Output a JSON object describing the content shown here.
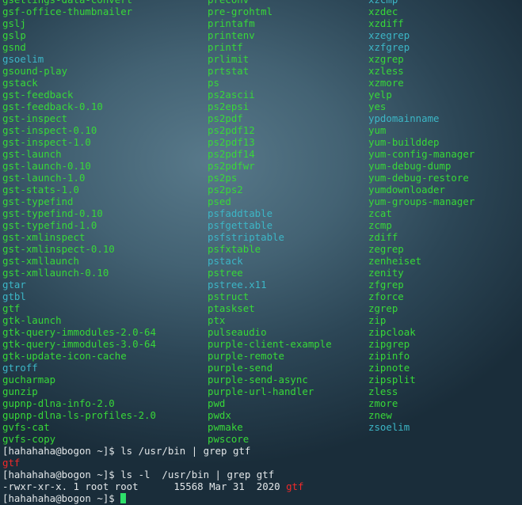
{
  "listing": {
    "col1": [
      {
        "n": "gsettings-data-convert",
        "t": "ex"
      },
      {
        "n": "gsf-office-thumbnailer",
        "t": "ex"
      },
      {
        "n": "gslj",
        "t": "ex"
      },
      {
        "n": "gslp",
        "t": "ex"
      },
      {
        "n": "gsnd",
        "t": "ex"
      },
      {
        "n": "gsoelim",
        "t": "ln"
      },
      {
        "n": "gsound-play",
        "t": "ex"
      },
      {
        "n": "gstack",
        "t": "ex"
      },
      {
        "n": "gst-feedback",
        "t": "ex"
      },
      {
        "n": "gst-feedback-0.10",
        "t": "ex"
      },
      {
        "n": "gst-inspect",
        "t": "ex"
      },
      {
        "n": "gst-inspect-0.10",
        "t": "ex"
      },
      {
        "n": "gst-inspect-1.0",
        "t": "ex"
      },
      {
        "n": "gst-launch",
        "t": "ex"
      },
      {
        "n": "gst-launch-0.10",
        "t": "ex"
      },
      {
        "n": "gst-launch-1.0",
        "t": "ex"
      },
      {
        "n": "gst-stats-1.0",
        "t": "ex"
      },
      {
        "n": "gst-typefind",
        "t": "ex"
      },
      {
        "n": "gst-typefind-0.10",
        "t": "ex"
      },
      {
        "n": "gst-typefind-1.0",
        "t": "ex"
      },
      {
        "n": "gst-xmlinspect",
        "t": "ex"
      },
      {
        "n": "gst-xmlinspect-0.10",
        "t": "ex"
      },
      {
        "n": "gst-xmllaunch",
        "t": "ex"
      },
      {
        "n": "gst-xmllaunch-0.10",
        "t": "ex"
      },
      {
        "n": "gtar",
        "t": "ln"
      },
      {
        "n": "gtbl",
        "t": "ln"
      },
      {
        "n": "gtf",
        "t": "ex"
      },
      {
        "n": "gtk-launch",
        "t": "ex"
      },
      {
        "n": "gtk-query-immodules-2.0-64",
        "t": "ex"
      },
      {
        "n": "gtk-query-immodules-3.0-64",
        "t": "ex"
      },
      {
        "n": "gtk-update-icon-cache",
        "t": "ex"
      },
      {
        "n": "gtroff",
        "t": "ln"
      },
      {
        "n": "gucharmap",
        "t": "ex"
      },
      {
        "n": "gunzip",
        "t": "ex"
      },
      {
        "n": "gupnp-dlna-info-2.0",
        "t": "ex"
      },
      {
        "n": "gupnp-dlna-ls-profiles-2.0",
        "t": "ex"
      },
      {
        "n": "gvfs-cat",
        "t": "ex"
      },
      {
        "n": "gvfs-copy",
        "t": "ex"
      }
    ],
    "col2": [
      {
        "n": "preconv",
        "t": "ex"
      },
      {
        "n": "pre-grohtml",
        "t": "ex"
      },
      {
        "n": "printafm",
        "t": "ex"
      },
      {
        "n": "printenv",
        "t": "ex"
      },
      {
        "n": "printf",
        "t": "ex"
      },
      {
        "n": "prlimit",
        "t": "ex"
      },
      {
        "n": "prtstat",
        "t": "ex"
      },
      {
        "n": "ps",
        "t": "ex"
      },
      {
        "n": "ps2ascii",
        "t": "ex"
      },
      {
        "n": "ps2epsi",
        "t": "ex"
      },
      {
        "n": "ps2pdf",
        "t": "ex"
      },
      {
        "n": "ps2pdf12",
        "t": "ex"
      },
      {
        "n": "ps2pdf13",
        "t": "ex"
      },
      {
        "n": "ps2pdf14",
        "t": "ex"
      },
      {
        "n": "ps2pdfwr",
        "t": "ex"
      },
      {
        "n": "ps2ps",
        "t": "ex"
      },
      {
        "n": "ps2ps2",
        "t": "ex"
      },
      {
        "n": "psed",
        "t": "ex"
      },
      {
        "n": "psfaddtable",
        "t": "ln"
      },
      {
        "n": "psfgettable",
        "t": "ln"
      },
      {
        "n": "psfstriptable",
        "t": "ln"
      },
      {
        "n": "psfxtable",
        "t": "ex"
      },
      {
        "n": "pstack",
        "t": "ln"
      },
      {
        "n": "pstree",
        "t": "ex"
      },
      {
        "n": "pstree.x11",
        "t": "ln"
      },
      {
        "n": "pstruct",
        "t": "ex"
      },
      {
        "n": "ptaskset",
        "t": "ex"
      },
      {
        "n": "ptx",
        "t": "ex"
      },
      {
        "n": "pulseaudio",
        "t": "ex"
      },
      {
        "n": "purple-client-example",
        "t": "ex"
      },
      {
        "n": "purple-remote",
        "t": "ex"
      },
      {
        "n": "purple-send",
        "t": "ex"
      },
      {
        "n": "purple-send-async",
        "t": "ex"
      },
      {
        "n": "purple-url-handler",
        "t": "ex"
      },
      {
        "n": "pwd",
        "t": "ex"
      },
      {
        "n": "pwdx",
        "t": "ex"
      },
      {
        "n": "pwmake",
        "t": "ex"
      },
      {
        "n": "pwscore",
        "t": "ex"
      }
    ],
    "col3": [
      {
        "n": "xzcmp",
        "t": "ln"
      },
      {
        "n": "xzdec",
        "t": "ex"
      },
      {
        "n": "xzdiff",
        "t": "ex"
      },
      {
        "n": "xzegrep",
        "t": "ln"
      },
      {
        "n": "xzfgrep",
        "t": "ln"
      },
      {
        "n": "xzgrep",
        "t": "ex"
      },
      {
        "n": "xzless",
        "t": "ex"
      },
      {
        "n": "xzmore",
        "t": "ex"
      },
      {
        "n": "yelp",
        "t": "ex"
      },
      {
        "n": "yes",
        "t": "ex"
      },
      {
        "n": "ypdomainname",
        "t": "ln"
      },
      {
        "n": "yum",
        "t": "ex"
      },
      {
        "n": "yum-builddep",
        "t": "ex"
      },
      {
        "n": "yum-config-manager",
        "t": "ex"
      },
      {
        "n": "yum-debug-dump",
        "t": "ex"
      },
      {
        "n": "yum-debug-restore",
        "t": "ex"
      },
      {
        "n": "yumdownloader",
        "t": "ex"
      },
      {
        "n": "yum-groups-manager",
        "t": "ex"
      },
      {
        "n": "zcat",
        "t": "ex"
      },
      {
        "n": "zcmp",
        "t": "ex"
      },
      {
        "n": "zdiff",
        "t": "ex"
      },
      {
        "n": "zegrep",
        "t": "ex"
      },
      {
        "n": "zenheiset",
        "t": "ex"
      },
      {
        "n": "zenity",
        "t": "ex"
      },
      {
        "n": "zfgrep",
        "t": "ex"
      },
      {
        "n": "zforce",
        "t": "ex"
      },
      {
        "n": "zgrep",
        "t": "ex"
      },
      {
        "n": "zip",
        "t": "ex"
      },
      {
        "n": "zipcloak",
        "t": "ex"
      },
      {
        "n": "zipgrep",
        "t": "ex"
      },
      {
        "n": "zipinfo",
        "t": "ex"
      },
      {
        "n": "zipnote",
        "t": "ex"
      },
      {
        "n": "zipsplit",
        "t": "ex"
      },
      {
        "n": "zless",
        "t": "ex"
      },
      {
        "n": "zmore",
        "t": "ex"
      },
      {
        "n": "znew",
        "t": "ex"
      },
      {
        "n": "zsoelim",
        "t": "ln"
      }
    ]
  },
  "session": {
    "line1_prompt": "[hahahaha@bogon ~]$ ",
    "line1_cmd": "ls /usr/bin | grep gtf",
    "line2_match": "gtf",
    "line3_prompt": "[hahahaha@bogon ~]$ ",
    "line3_cmd": "ls -l  /usr/bin | grep gtf",
    "line4_info": "-rwxr-xr-x. 1 root root      15568 Mar 31  2020 ",
    "line4_match": "gtf",
    "line5_prompt": "[hahahaha@bogon ~]$ "
  },
  "colors": {
    "executable": "#38d838",
    "symlink": "#3cb6c6",
    "grep_match": "#f02a2a",
    "cursor": "#2ee06a"
  }
}
